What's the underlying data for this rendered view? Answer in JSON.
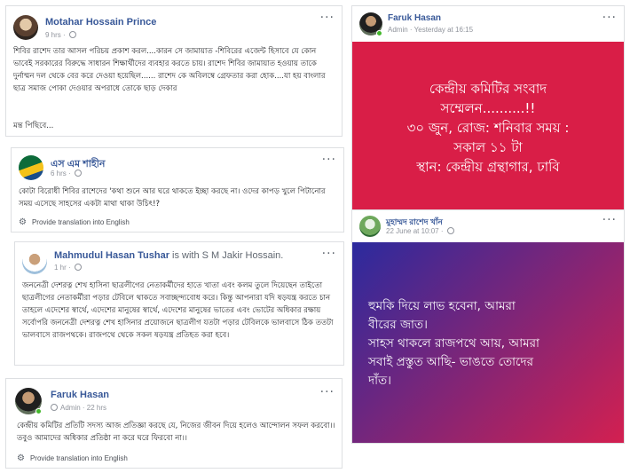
{
  "post1": {
    "author": "Motahar Hossain Prince",
    "time": "9 hrs · ",
    "text": "শিবির রাশেদ তার আসল পরিচয় প্রকাশ করল....কারন সে জামায়াত -শিবিরের এজেন্ট হিসাবে যে কোন ভাবেই সরকারের বিরুদ্ধে সাধারন শিক্ষার্থীদের ব্যবহার করতে চায়। রাশেদ শিবির জামায়াত হওয়ায় তাকে দুর্নাম্মন দল থেকে বের করে দেওয়া হয়েছিল...... রাশেদ কে অবিলম্বে গ্রেফতার করা হোক....যা হয় বাংলার ছাত্র সমাজ পোকা দেওয়ার অপরাধে তোকে ছাড় দেকার",
    "see_more": "মন্ত পিছিবে..."
  },
  "post2": {
    "author": "এস এম শাহীন",
    "time": "6 hrs · ",
    "text": "কোটা বিরোধী শিবির রাশেদের 'কথা শুনে আর ঘরে থাকতে ইচ্ছা করছে না। ওদের কাপড় খুলে পিটানোর সময় এসেছে সাহসের একটা মাথা থাকা উচিৎ!?",
    "translate": "Provide translation into English"
  },
  "post3": {
    "author": "Mahmudul Hasan Tushar",
    "with_text": "is with S M Jakir Hossain.",
    "time": "1 hr · ",
    "text": "জননেত্রী দেশরত্ন শেখ হাসিনা ছাত্রলীগের নেতাকর্মীদের হাতে খাতা এবং কলম তুলে দিয়েছেন তাইতো ছাত্রলীগের নেতাকর্মীরা পড়ার টেবিলে থাকতে সবাচ্ছন্দ্যবোধ করে। কিন্তু আপনারা যদি ষড়যন্ত্র করতে চান তাহলে এদেশের স্বার্থে, এদেশের মানুষের স্বার্থে, এদেশের মানুষের ভাতের এবং ভোটের অধিকার রক্ষায় সর্বোপরি জননেত্রী দেশরত্ন শেখ হাসিনার প্রয়োজনে ছাত্রলীগ যতটা পড়ার টেবিলকে ভালবাসে ঠিক ততটা ভালবাসে রাজপথকে। রাজপথে থেকে সকল ষড়যন্ত্র প্রতিহত করা হবে।"
  },
  "post4": {
    "author": "Faruk Hasan",
    "time": "Admin · 22 hrs",
    "text": "কেন্দ্রীয় কমিটির প্রতিটি সদস্য আজ প্রতিজ্ঞা করছে যে, নিজের জীবন দিয়ে হলেও আন্দোলন সফল করবো।। তবুও আমাদের অধিকার প্রতিষ্ঠা না করে ঘরে ফিরবো না।।",
    "translate": "Provide translation into English"
  },
  "post5": {
    "author": "Faruk Hasan",
    "time": "Admin · Yesterday at 16:15",
    "banner_lines": [
      "কেন্দ্রীয় কমিটির সংবাদ",
      "সম্মেলন..........!!",
      "৩০ জুন, রোজ: শনিবার সময় :",
      "সকাল ১১ টা",
      "স্থান: কেন্দ্রীয় গ্রন্থাগার, ঢাবি"
    ],
    "banner_color": "#d91e47"
  },
  "post6": {
    "author": "মুহাম্মদ রাশেদ খাঁন",
    "time": "22 June at 10:07 · ",
    "banner_lines": [
      "হুমকি দিয়ে লাভ হবেনা, আমরা",
      "বীরের জাত।",
      "সাহস থাকলে রাজপথে আয়, আমরা",
      "সবাই প্রস্তুত আছি- ভাঙতে তোদের",
      "দাঁত।"
    ],
    "gradient_from": "#2b2a9e",
    "gradient_to": "#d42050"
  },
  "icons": {
    "more": "···",
    "gear": "⚙"
  }
}
